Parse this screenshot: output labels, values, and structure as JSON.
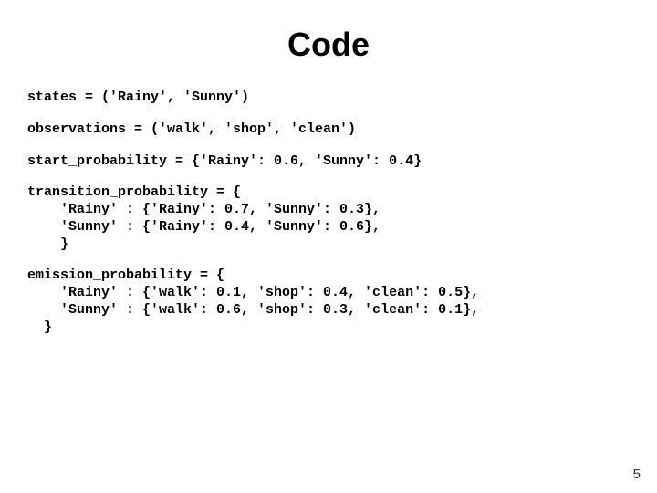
{
  "title": "Code",
  "code": {
    "line1": "states = ('Rainy', 'Sunny')",
    "line2": "observations = ('walk', 'shop', 'clean')",
    "line3": "start_probability = {'Rainy': 0.6, 'Sunny': 0.4}",
    "line4": "transition_probability = {",
    "line5": "    'Rainy' : {'Rainy': 0.7, 'Sunny': 0.3},",
    "line6": "    'Sunny' : {'Rainy': 0.4, 'Sunny': 0.6},",
    "line7": "    }",
    "line8": "emission_probability = {",
    "line9": "    'Rainy' : {'walk': 0.1, 'shop': 0.4, 'clean': 0.5},",
    "line10": "    'Sunny' : {'walk': 0.6, 'shop': 0.3, 'clean': 0.1},",
    "line11": "  }"
  },
  "page_number": "5"
}
